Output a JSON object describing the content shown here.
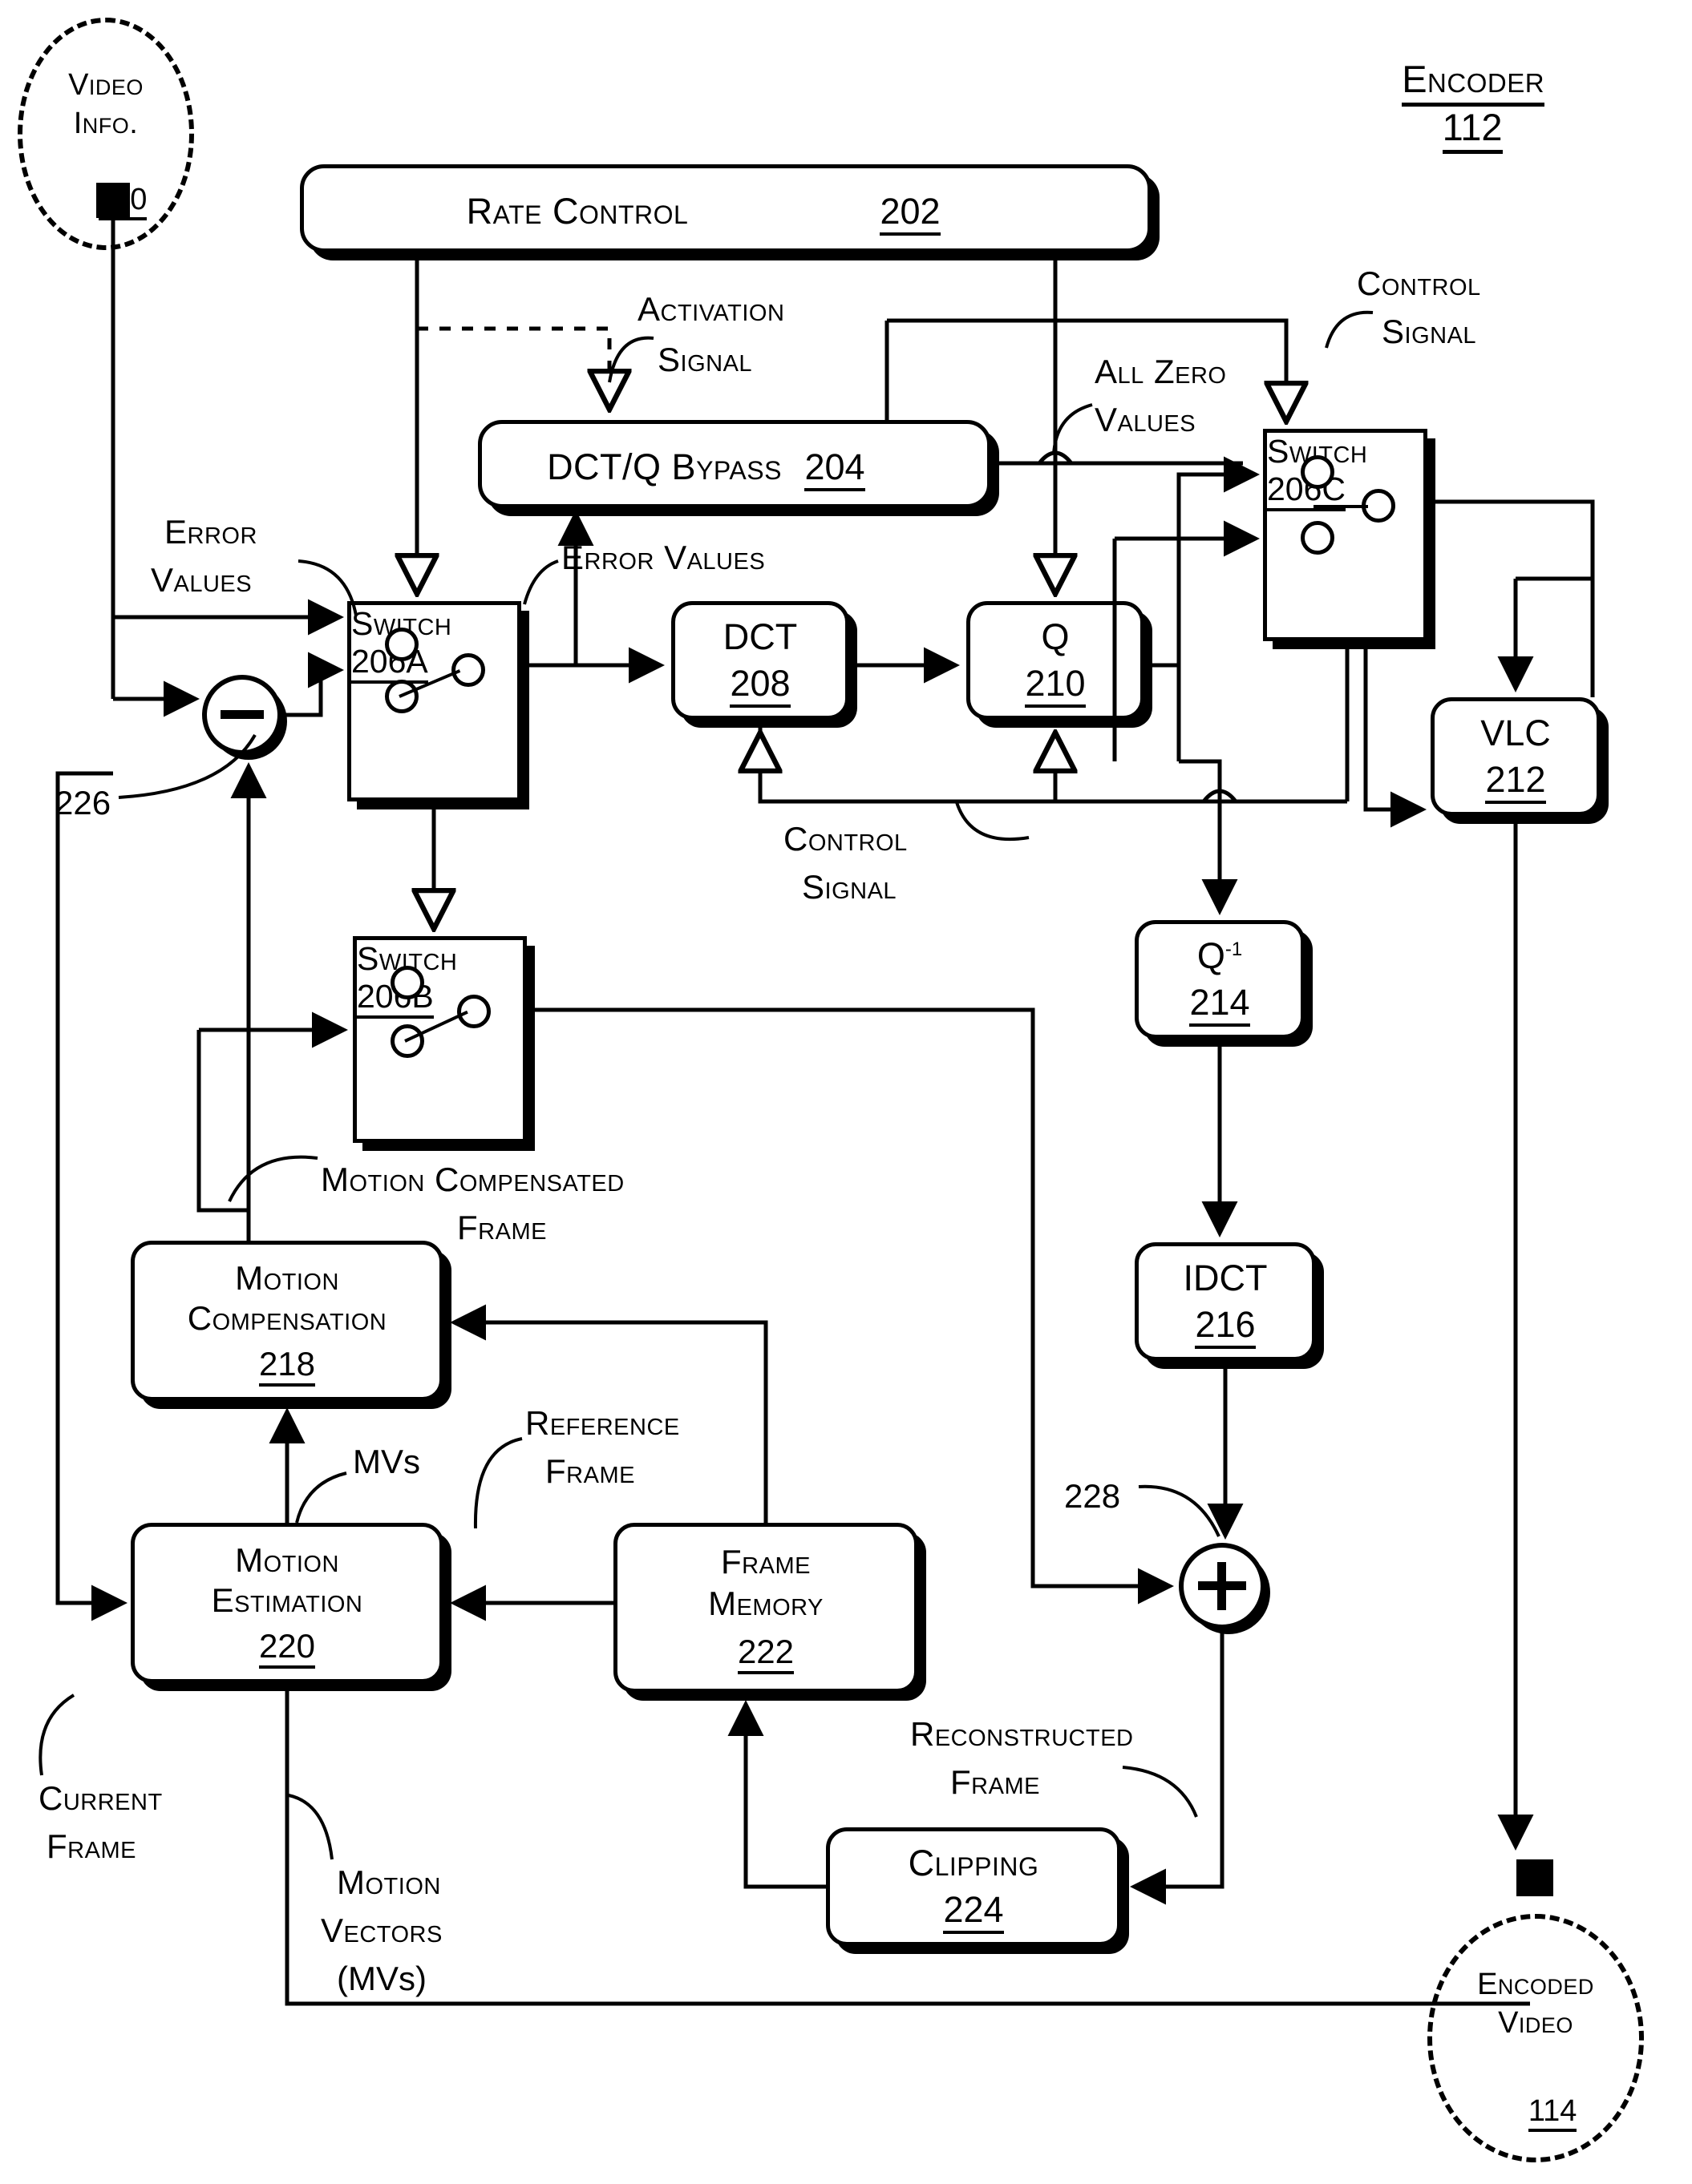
{
  "figure": {
    "title": "Encoder",
    "title_ref": "112"
  },
  "terminals": {
    "input": {
      "line1": "Video",
      "line2": "Info.",
      "ref": "110"
    },
    "output": {
      "line1": "Encoded",
      "line2": "Video",
      "ref": "114"
    }
  },
  "blocks": {
    "rate_control": {
      "label": "Rate Control",
      "ref": "202"
    },
    "dct_q_bypass": {
      "label": "DCT/Q Bypass",
      "ref": "204"
    },
    "dct": {
      "label": "DCT",
      "ref": "208"
    },
    "q": {
      "label": "Q",
      "ref": "210"
    },
    "vlc": {
      "label": "VLC",
      "ref": "212"
    },
    "q_inv": {
      "label": "Q",
      "sup": "-1",
      "ref": "214"
    },
    "idct": {
      "label": "IDCT",
      "ref": "216"
    },
    "motion_compensation": {
      "line1": "Motion",
      "line2": "Compensation",
      "ref": "218"
    },
    "motion_estimation": {
      "line1": "Motion",
      "line2": "Estimation",
      "ref": "220"
    },
    "frame_memory": {
      "line1": "Frame",
      "line2": "Memory",
      "ref": "222"
    },
    "clipping": {
      "label": "Clipping",
      "ref": "224"
    },
    "switch_a": {
      "label": "Switch",
      "ref": "206A"
    },
    "switch_b": {
      "label": "Switch",
      "ref": "206B"
    },
    "switch_c": {
      "label": "Switch",
      "ref": "206C"
    }
  },
  "nodes": {
    "subtractor": {
      "ref": "226",
      "symbol": "minus"
    },
    "adder": {
      "ref": "228",
      "symbol": "plus"
    }
  },
  "signal_labels": {
    "activation_signal": {
      "line1": "Activation",
      "line2": "Signal"
    },
    "control_signal_top": {
      "line1": "Control",
      "line2": "Signal"
    },
    "control_signal_mid": {
      "line1": "Control",
      "line2": "Signal"
    },
    "all_zero_values": {
      "line1": "All Zero",
      "line2": "Values"
    },
    "error_values_left": {
      "line1": "Error",
      "line2": "Values"
    },
    "error_values_bypass": {
      "text": "Error Values"
    },
    "motion_compensated_frame": {
      "line1": "Motion Compensated",
      "line2": "Frame"
    },
    "reference_frame": {
      "line1": "Reference",
      "line2": "Frame"
    },
    "mvs": {
      "text": "MVs"
    },
    "motion_vectors": {
      "line1": "Motion",
      "line2": "Vectors",
      "line3": "(MVs)"
    },
    "current_frame": {
      "line1": "Current",
      "line2": "Frame"
    },
    "reconstructed_frame": {
      "line1": "Reconstructed",
      "line2": "Frame"
    }
  },
  "colors": {
    "ink": "#000000",
    "paper": "#ffffff"
  }
}
